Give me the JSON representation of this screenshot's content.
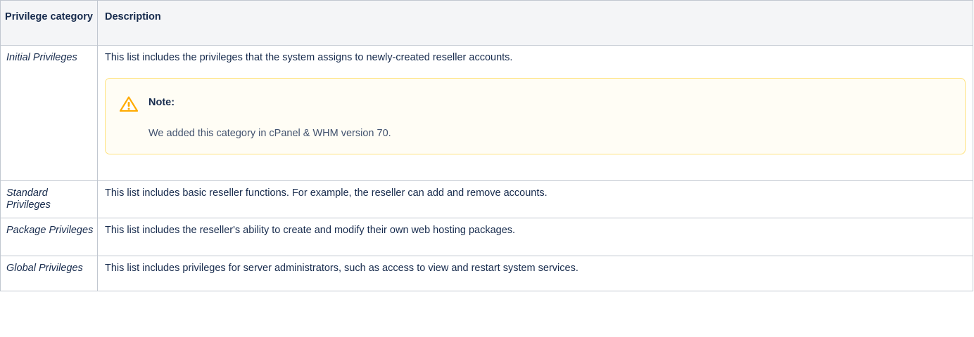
{
  "table": {
    "headers": {
      "category": "Privilege category",
      "description": "Description"
    },
    "rows": [
      {
        "category": "Initial Privileges",
        "description": "This list includes the privileges that the system assigns to newly-created reseller accounts.",
        "note": {
          "icon": "warning-icon",
          "title": "Note:",
          "body": "We added this category in cPanel & WHM version 70."
        }
      },
      {
        "category": "Standard Privileges",
        "description": "This list includes basic reseller functions. For example, the reseller can add and remove accounts."
      },
      {
        "category": "Package Privileges",
        "description": "This list includes the reseller's ability to create and modify their own web hosting packages."
      },
      {
        "category": "Global Privileges",
        "description": "This list includes privileges for server administrators, such as access to view and restart system services."
      }
    ]
  },
  "colors": {
    "border": "#c1c7d0",
    "header_bg": "#f4f5f7",
    "note_border": "#ffe380",
    "note_bg": "#fffdf5",
    "warning_icon": "#ffab00",
    "text": "#172b4d"
  }
}
